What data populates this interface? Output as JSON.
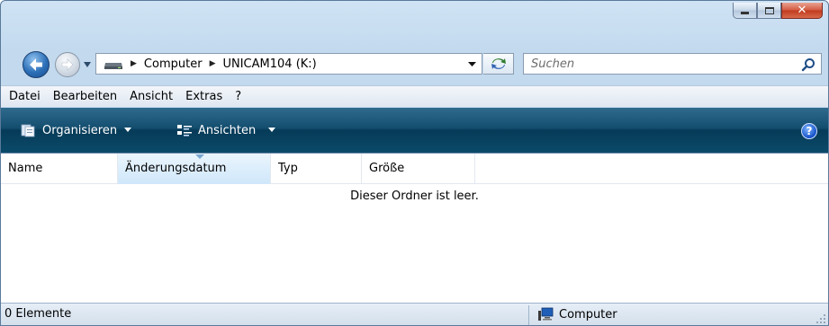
{
  "window": {
    "caption_buttons": [
      {
        "name": "minimize",
        "icon": "minimize-icon"
      },
      {
        "name": "maximize",
        "icon": "maximize-icon"
      },
      {
        "name": "close",
        "icon": "close-icon"
      }
    ]
  },
  "navigation": {
    "back_icon": "back-arrow-icon",
    "forward_icon": "forward-arrow-icon",
    "breadcrumb": [
      "Computer",
      "UNICAM104 (K:)"
    ],
    "drive_icon": "removable-drive-icon",
    "refresh_icon": "refresh-icon"
  },
  "search": {
    "placeholder": "Suchen",
    "icon": "search-icon"
  },
  "menu": {
    "items": [
      "Datei",
      "Bearbeiten",
      "Ansicht",
      "Extras",
      "?"
    ]
  },
  "toolbar": {
    "organize_label": "Organisieren",
    "views_label": "Ansichten",
    "help_icon": "help-icon",
    "help_label": "?"
  },
  "columns": [
    "Name",
    "Änderungsdatum",
    "Typ",
    "Größe"
  ],
  "content": {
    "empty_message": "Dieser Ordner ist leer."
  },
  "status": {
    "item_count": "0 Elemente",
    "zone_label": "Computer"
  },
  "colors": {
    "command_bar": "#0b4a6a",
    "close_button": "#c03a1e",
    "window_frame": "#c2d9ee"
  }
}
